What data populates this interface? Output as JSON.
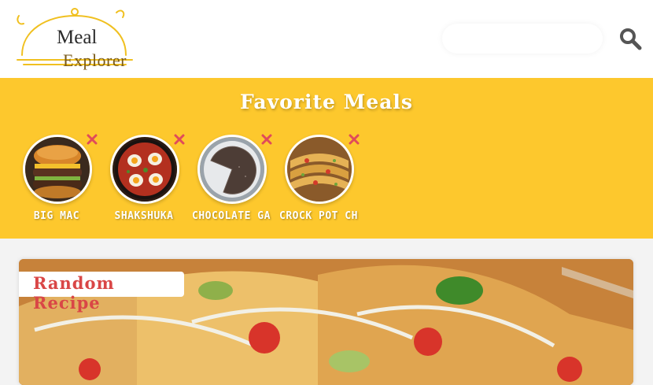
{
  "header": {
    "logo": {
      "line1": "Meal",
      "line2": "Explorer"
    },
    "search": {
      "placeholder": "",
      "value": ""
    },
    "search_icon": "search-icon"
  },
  "favorites": {
    "title": "Favorite Meals",
    "meals": [
      {
        "label": "BIG MAC"
      },
      {
        "label": "SHAKSHUKA"
      },
      {
        "label": "CHOCOLATE GA"
      },
      {
        "label": "CROCK POT CH"
      }
    ],
    "remove_icon": "close-icon"
  },
  "random": {
    "tag": "Random Recipe"
  },
  "colors": {
    "accent": "#fdc82d",
    "remove": "#e04b5a",
    "tag_text": "#d94646",
    "background": "#f3f3f3"
  }
}
